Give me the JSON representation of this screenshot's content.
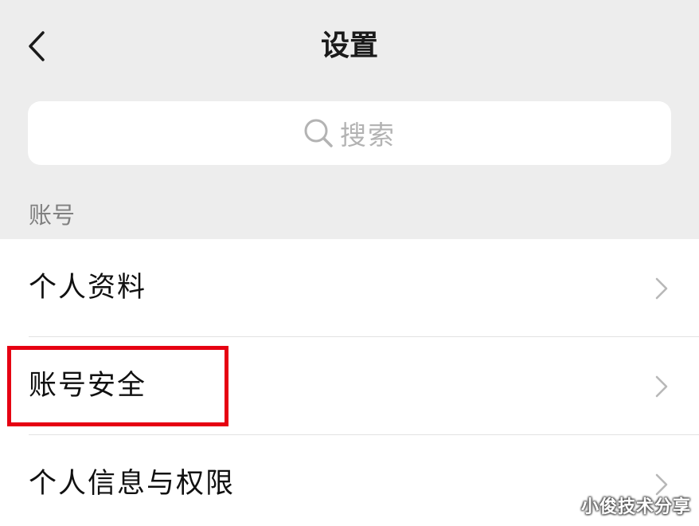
{
  "header": {
    "title": "设置",
    "back_icon": "chevron-left-icon"
  },
  "search": {
    "placeholder": "搜索",
    "icon": "search-icon"
  },
  "section": {
    "label": "账号"
  },
  "items": [
    {
      "label": "个人资料",
      "icon": "chevron-right-icon"
    },
    {
      "label": "账号安全",
      "icon": "chevron-right-icon",
      "highlighted": true
    },
    {
      "label": "个人信息与权限",
      "icon": "chevron-right-icon"
    }
  ],
  "watermark": "小俊技术分享",
  "colors": {
    "header_bg": "#ededed",
    "highlight": "#e60012",
    "text": "#111111",
    "muted": "#808080"
  }
}
